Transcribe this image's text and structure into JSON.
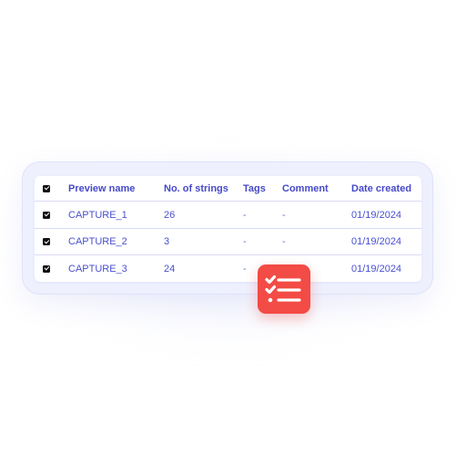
{
  "table": {
    "headers": {
      "name": "Preview name",
      "strings": "No. of strings",
      "tags": "Tags",
      "comment": "Comment",
      "date": "Date created"
    },
    "rows": [
      {
        "checked": true,
        "name": "CAPTURE_1",
        "strings": "26",
        "tags": "-",
        "comment": "-",
        "date": "01/19/2024"
      },
      {
        "checked": true,
        "name": "CAPTURE_2",
        "strings": "3",
        "tags": "-",
        "comment": "-",
        "date": "01/19/2024"
      },
      {
        "checked": true,
        "name": "CAPTURE_3",
        "strings": "24",
        "tags": "-",
        "comment": "",
        "date": "01/19/2024"
      }
    ]
  },
  "app_icon": {
    "icon": "checklist-icon",
    "color": "#f34b45"
  },
  "colors": {
    "accent_text": "#4a4fd0",
    "panel_bg": "#eef0fd",
    "divider": "#d8dbf6",
    "checkbox": "#111111"
  }
}
